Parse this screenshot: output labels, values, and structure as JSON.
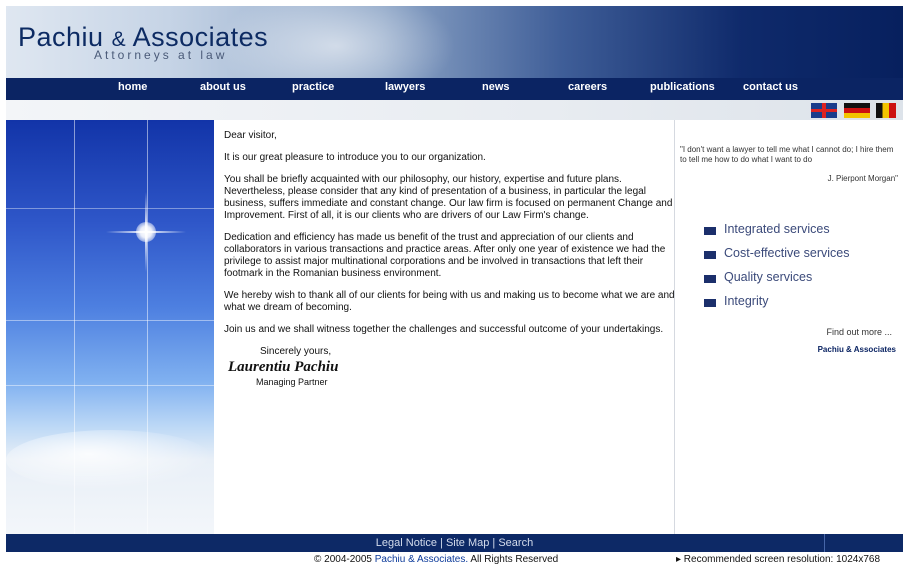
{
  "header": {
    "brand": "Pachiu",
    "brand_amp": "&",
    "brand_rest": "Associates",
    "tagline": "Attorneys at law"
  },
  "nav": {
    "items": [
      "home",
      "about us",
      "practice",
      "lawyers",
      "news",
      "careers",
      "publications",
      "contact us"
    ]
  },
  "flags": [
    "uk-flag-icon",
    "germany-flag-icon",
    "belgium-flag-icon"
  ],
  "letter": {
    "greeting": "Dear visitor,",
    "p1": "It is our great pleasure to introduce you to our organization.",
    "p2": "You shall be briefly acquainted with our philosophy, our history, expertise and future plans. Nevertheless, please consider that any kind of presentation of a business, in particular the legal business, suffers immediate and constant change. Our law firm is focused on permanent Change and Improvement. First of all, it is our clients who are drivers of our Law Firm's change.",
    "p3": "Dedication and efficiency has made us benefit of the trust and appreciation of our clients and collaborators in various transactions and practice areas. After only one year of existence we had the privilege to assist major multinational corporations and be involved in transactions that left their footmark in the Romanian business environment.",
    "p4": "We hereby wish to thank all of our clients for being with us and making us to become what we are and what we dream of becoming.",
    "p5": "Join us and we shall witness together the challenges and successful outcome of your undertakings.",
    "closing": "Sincerely yours,",
    "signature": "Laurentiu Pachiu",
    "role": "Managing Partner"
  },
  "sidebar": {
    "quote": "\"I don't want a lawyer to tell me what I cannot do; I hire them to tell me how to do what I want to do",
    "quote_author": "J. Pierpont Morgan\"",
    "features": [
      "Integrated services",
      "Cost-effective services",
      "Quality services",
      "Integrity"
    ],
    "find_out": "Find out more ...",
    "find_out_brand": "Pachiu & Associates"
  },
  "footer": {
    "legal": "Legal Notice",
    "sitemap": "Site Map",
    "search": "Search",
    "sep": "|",
    "copyright_pre": "© 2004-2005",
    "copyright_brand": "Pachiu & Associates.",
    "copyright_post": "All Rights Reserved",
    "resolution": "▸ Recommended screen resolution: 1024x768"
  },
  "colors": {
    "nav_bg": "#0b2463",
    "brand_text": "#0d2b63",
    "feature_text": "#3b4a7a"
  }
}
